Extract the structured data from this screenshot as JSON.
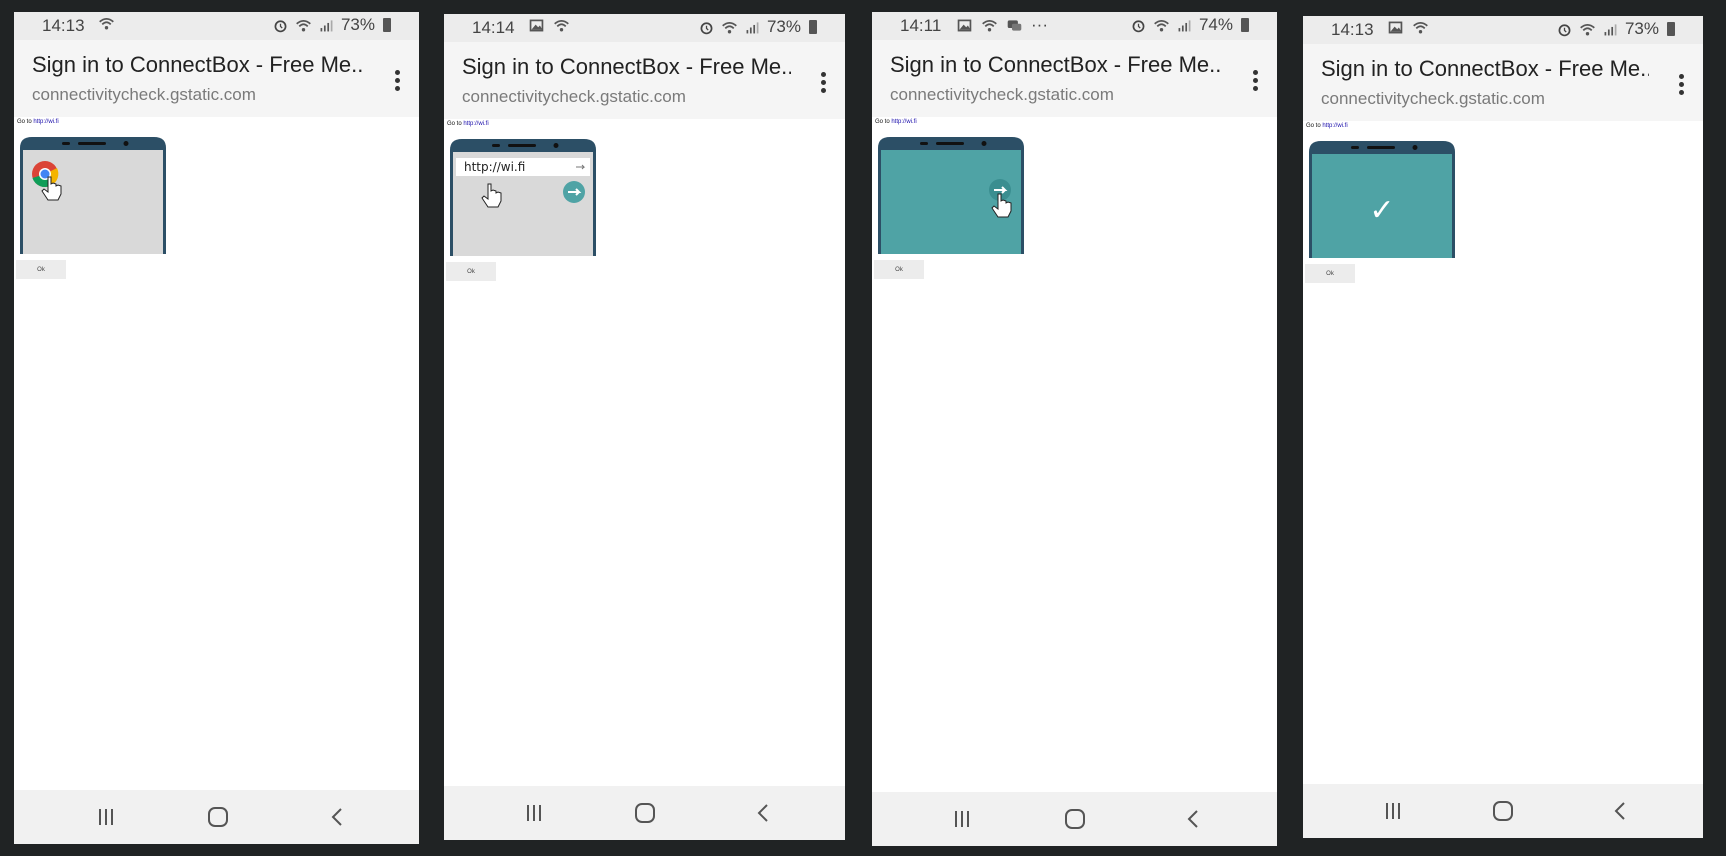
{
  "phones": [
    {
      "status": {
        "time": "14:13",
        "battery": "73%"
      },
      "appbar": {
        "title": "Sign in to ConnectBox - Free Me...",
        "url": "connectivitycheck.gstatic.com"
      },
      "page": {
        "goto_prefix": "Go to ",
        "goto_link": "http://wi.fi",
        "ok_label": "Ok"
      }
    },
    {
      "status": {
        "time": "14:14",
        "battery": "73%"
      },
      "appbar": {
        "title": "Sign in to ConnectBox - Free Me...",
        "url": "connectivitycheck.gstatic.com"
      },
      "page": {
        "goto_prefix": "Go to ",
        "goto_link": "http://wi.fi",
        "ok_label": "Ok",
        "address_text": "http://wi.fi"
      }
    },
    {
      "status": {
        "time": "14:11",
        "battery": "74%",
        "more": "···"
      },
      "appbar": {
        "title": "Sign in to ConnectBox - Free Me...",
        "url": "connectivitycheck.gstatic.com"
      },
      "page": {
        "goto_prefix": "Go to ",
        "goto_link": "http://wi.fi",
        "ok_label": "Ok"
      }
    },
    {
      "status": {
        "time": "14:13",
        "battery": "73%"
      },
      "appbar": {
        "title": "Sign in to ConnectBox - Free Me...",
        "url": "connectivitycheck.gstatic.com"
      },
      "page": {
        "goto_prefix": "Go to ",
        "goto_link": "http://wi.fi",
        "ok_label": "Ok",
        "check_mark": "✓"
      }
    }
  ],
  "icons": {
    "wifi": "wifi-icon",
    "alarm": "alarm-icon",
    "signal": "signal-icon",
    "battery": "battery-icon",
    "gallery": "gallery-icon",
    "menu": "more-vertical-icon",
    "chrome": "chrome-icon",
    "hand": "hand-pointer-icon",
    "go_arrow": "arrow-right-icon",
    "recents": "recents-icon",
    "home": "home-icon",
    "back": "back-icon"
  },
  "colors": {
    "background": "#202324",
    "statusbar": "#ececec",
    "appbar": "#f5f5f5",
    "phone_frame": "#2c4f66",
    "screen_gray": "#d9d9d9",
    "teal": "#4fa3a5",
    "link": "#1a0dab"
  }
}
